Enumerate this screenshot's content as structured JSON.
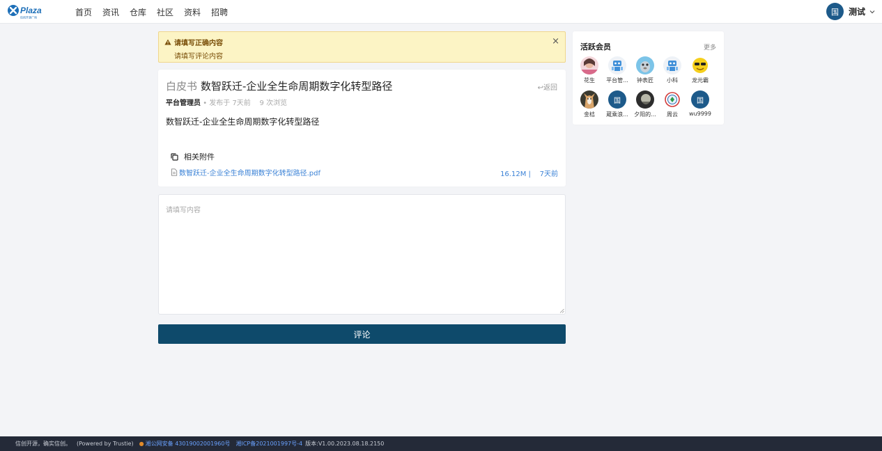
{
  "header": {
    "logo_text": "Plaza",
    "logo_subtext": "信创开源广场",
    "nav": [
      "首页",
      "资讯",
      "仓库",
      "社区",
      "资料",
      "招聘"
    ],
    "user": {
      "avatar_char": "国",
      "name": "测试"
    }
  },
  "alert": {
    "title": "请填写正确内容",
    "message": "请填写评论内容",
    "close": "×"
  },
  "post": {
    "category": "白皮书",
    "title": "数智跃迁-企业全生命周期数字化转型路径",
    "back": "返回",
    "author": "平台管理员",
    "published": "发布于 7天前",
    "views": "9 次浏览",
    "body": "数智跃迁-企业全生命周期数字化转型路径",
    "attachments_heading": "相关附件",
    "attachment": {
      "name": "数智跃迁-企业全生命周期数字化转型路径.pdf",
      "size": "16.12M",
      "separator": "|",
      "time": "7天前"
    }
  },
  "comment": {
    "placeholder": "请填写内容",
    "submit_label": "评论"
  },
  "members": {
    "title": "活跃会员",
    "more": "更多",
    "list": [
      {
        "name": "花生",
        "avatar": "photo-pink"
      },
      {
        "name": "平台管...",
        "avatar": "robot-blue"
      },
      {
        "name": "钟表匠",
        "avatar": "cartoon-blue"
      },
      {
        "name": "小科",
        "avatar": "robot-blue"
      },
      {
        "name": "龙元霸",
        "avatar": "emoji-yellow"
      },
      {
        "name": "金桔",
        "avatar": "photo-dog"
      },
      {
        "name": "蔵乘浪...",
        "avatar": "initial",
        "char": "国"
      },
      {
        "name": "夕阳的...",
        "avatar": "photo-dark"
      },
      {
        "name": "周云",
        "avatar": "emblem"
      },
      {
        "name": "wu9999",
        "avatar": "initial",
        "char": "国"
      }
    ]
  },
  "footer": {
    "slogan": "信创开源，确实信创。",
    "powered": "(Powered by Trustie)",
    "police": "湘公网安备 43019002001960号",
    "icp": "湘ICP备2021001997号-4",
    "version": "版本:V1.00.2023.08.18.2150"
  },
  "colors": {
    "primary": "#0e4a6b",
    "avatar_bg": "#1d5a8a",
    "link": "#3b82d6",
    "alert_bg": "#fcf4c5",
    "footer_bg": "#242a38"
  }
}
